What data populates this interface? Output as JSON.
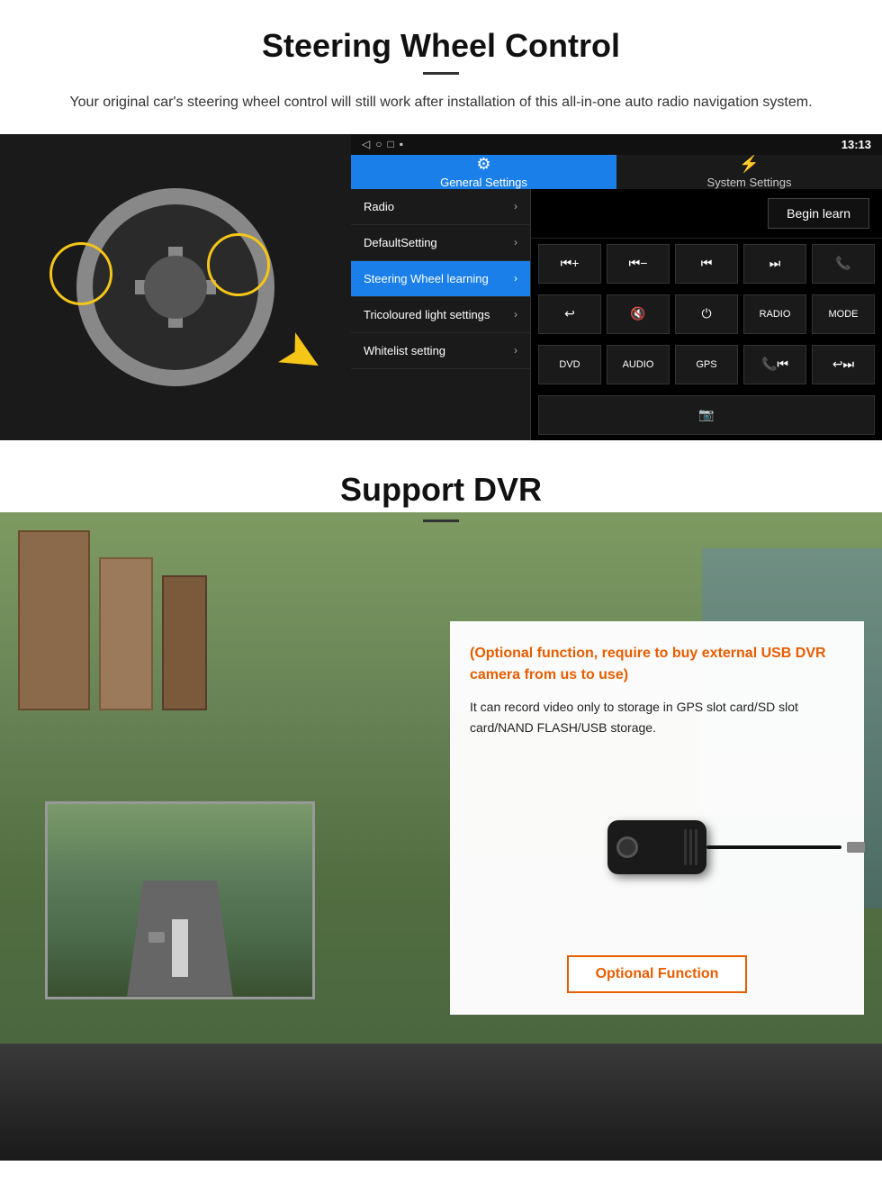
{
  "section1": {
    "title": "Steering Wheel Control",
    "subtitle": "Your original car's steering wheel control will still work after installation of this all-in-one auto radio navigation system.",
    "android": {
      "statusbar": {
        "time": "13:13",
        "icons": [
          "◁",
          "○",
          "□",
          "▪"
        ]
      },
      "tabs": [
        {
          "label": "General Settings",
          "icon": "⚙",
          "active": true
        },
        {
          "label": "System Settings",
          "icon": "🔗",
          "active": false
        }
      ],
      "menuItems": [
        {
          "label": "Radio",
          "active": false
        },
        {
          "label": "DefaultSetting",
          "active": false
        },
        {
          "label": "Steering Wheel learning",
          "active": true
        },
        {
          "label": "Tricoloured light settings",
          "active": false
        },
        {
          "label": "Whitelist setting",
          "active": false
        }
      ],
      "beginLearnBtn": "Begin learn",
      "controlRows": [
        [
          "⏮+",
          "⏮-",
          "⏮",
          "⏭",
          "📞"
        ],
        [
          "↩",
          "🔇",
          "⏻",
          "RADIO",
          "MODE"
        ],
        [
          "DVD",
          "AUDIO",
          "GPS",
          "📞⏮",
          "↩⏭"
        ],
        [
          "📷"
        ]
      ]
    }
  },
  "section2": {
    "title": "Support DVR",
    "optionalText": "(Optional function, require to buy external USB DVR camera from us to use)",
    "description": "It can record video only to storage in GPS slot card/SD slot card/NAND FLASH/USB storage.",
    "optionalFunctionBtn": "Optional Function"
  }
}
